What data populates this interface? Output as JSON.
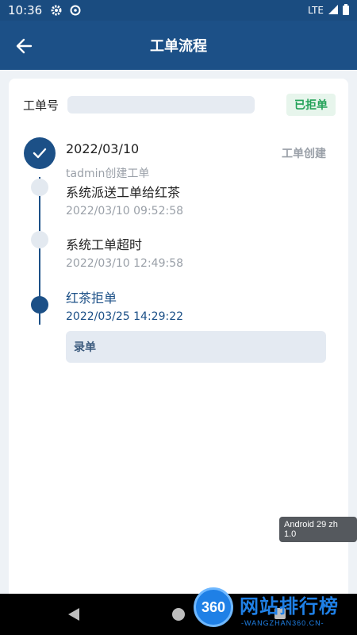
{
  "status_bar": {
    "time": "10:36",
    "network": "LTE",
    "icons": [
      "gear-icon",
      "sync-icon",
      "signal-icon",
      "battery-icon"
    ]
  },
  "app_bar": {
    "title": "工单流程",
    "back_icon": "arrow-left-icon"
  },
  "order": {
    "label": "工单号",
    "value": "",
    "status": "已拒单",
    "status_color": "#25a35a"
  },
  "timeline": {
    "first": {
      "date": "2022/03/10",
      "sub": "tadmin创建工单",
      "tag": "工单创建"
    },
    "steps": [
      {
        "title": "系统派送工单给红茶",
        "time": "2022/03/10  09:52:58"
      },
      {
        "title": "系统工单超时",
        "time": "2022/03/10  12:49:58"
      },
      {
        "title": "红茶拒单",
        "time": "2022/03/25  14:29:22"
      }
    ],
    "action": "录单"
  },
  "debug_chip": "Android 29 zh 1.0",
  "watermark": {
    "logo": "360",
    "text": "网站排行榜",
    "url": "-WANGZHAN360.CN-"
  },
  "colors": {
    "primary": "#1c5087",
    "background": "#eef2f6"
  }
}
